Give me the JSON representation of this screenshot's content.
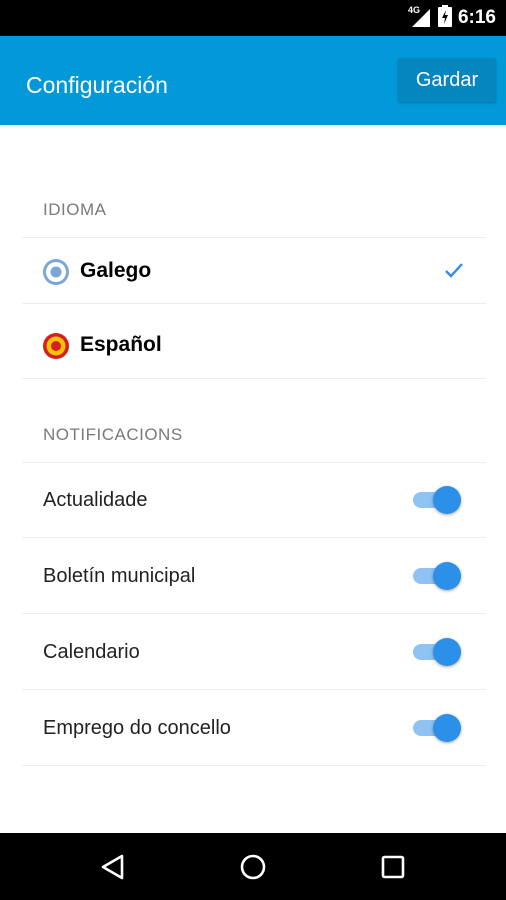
{
  "status_bar": {
    "network": "4G",
    "time": "6:16"
  },
  "app_bar": {
    "title": "Configuración",
    "save_label": "Gardar",
    "background": "#0399d8"
  },
  "language_section": {
    "header": "IDIOMA",
    "options": [
      {
        "label": "Galego",
        "selected": true,
        "icon": "galicia-flag-icon"
      },
      {
        "label": "Español",
        "selected": false,
        "icon": "spain-flag-icon"
      }
    ]
  },
  "notifications_section": {
    "header": "NOTIFICACIONS",
    "items": [
      {
        "label": "Actualidade",
        "enabled": true
      },
      {
        "label": "Boletín municipal",
        "enabled": true
      },
      {
        "label": "Calendario",
        "enabled": true
      },
      {
        "label": "Emprego do concello",
        "enabled": true
      }
    ]
  },
  "colors": {
    "accent": "#2c8fe8",
    "toggle_track": "#8ec3f4"
  },
  "nav_bar": {
    "buttons": [
      "back-icon",
      "home-icon",
      "recents-icon"
    ]
  }
}
